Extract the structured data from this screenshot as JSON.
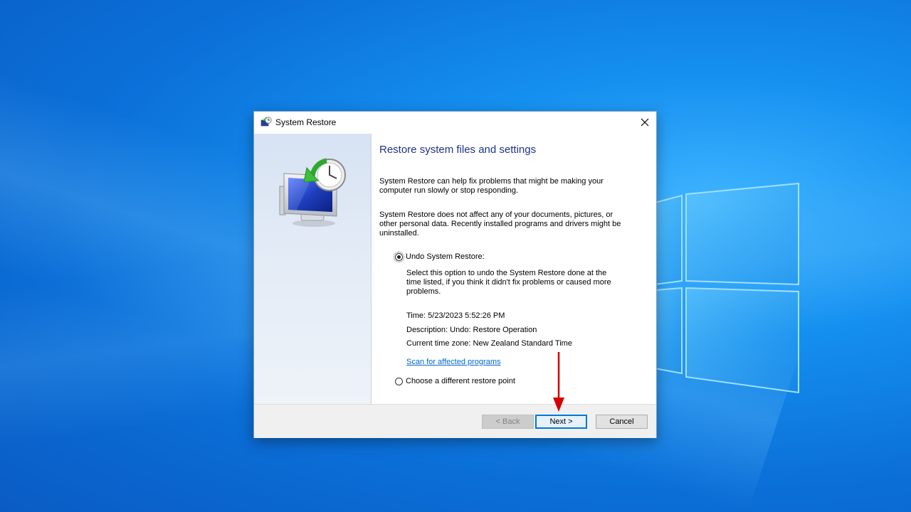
{
  "window": {
    "title": "System Restore"
  },
  "content": {
    "heading": "Restore system files and settings",
    "paragraph1": "System Restore can help fix problems that might be making your computer run slowly or stop responding.",
    "paragraph2": "System Restore does not affect any of your documents, pictures, or other personal data. Recently installed programs and drivers might be uninstalled."
  },
  "options": {
    "undo_label": "Undo System Restore:",
    "undo_selected": true,
    "undo_description": "Select this option to undo the System Restore done at the time listed, if you think it didn't fix problems or caused more problems.",
    "time": "Time: 5/23/2023 5:52:26 PM",
    "description": "Description: Undo: Restore Operation",
    "timezone": "Current time zone: New Zealand Standard Time",
    "scan_link": "Scan for affected programs",
    "choose_label": "Choose a different restore point",
    "choose_selected": false
  },
  "buttons": {
    "back": "< Back",
    "next": "Next >",
    "cancel": "Cancel"
  },
  "colors": {
    "heading": "#1e3287",
    "link": "#0066cc",
    "annotation_arrow": "#d40000",
    "focus_border": "#0078d7"
  }
}
